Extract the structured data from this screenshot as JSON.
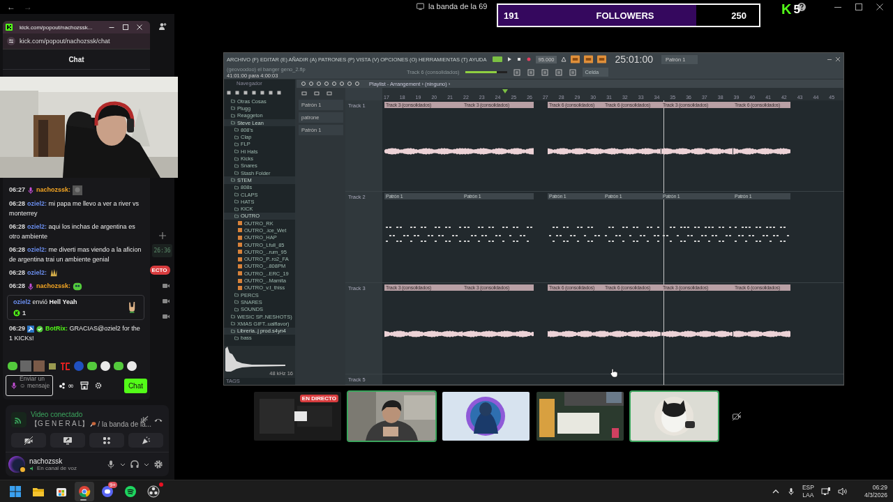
{
  "nav": {
    "back": "←",
    "forward": "→"
  },
  "window": {
    "title": "la banda de la 69"
  },
  "followers_goal": {
    "current": "191",
    "label": "FOLLOWERS",
    "target": "250",
    "level": 0.76
  },
  "kick_badge": {
    "logo": "K",
    "count": "5"
  },
  "popout": {
    "tab_title": "kick.com/popout/nachozssk...",
    "url": "kick.com/popout/nachozssk/chat",
    "header": "Chat"
  },
  "chat": {
    "messages": [
      {
        "kind": "emote",
        "time": "06:27",
        "user": "nachozssk:",
        "color": "#f5a623",
        "mic": true
      },
      {
        "kind": "text",
        "time": "06:28",
        "user": "oziel2:",
        "color": "#6b8ff0",
        "mic": false,
        "text": "mi papa me llevo a ver a river vs monterrey"
      },
      {
        "kind": "text",
        "time": "06:28",
        "user": "oziel2:",
        "color": "#6b8ff0",
        "mic": false,
        "text": "aqui los inchas de argentina es otro ambiente"
      },
      {
        "kind": "text",
        "time": "06:28",
        "user": "oziel2:",
        "color": "#6b8ff0",
        "mic": false,
        "text": "me diverti mas viendo a la aficion de argentina trai un ambiente genial"
      },
      {
        "kind": "emote",
        "time": "06:28",
        "user": "oziel2:",
        "color": "#6b8ff0",
        "mic": false
      },
      {
        "kind": "emote",
        "time": "06:28",
        "user": "nachozssk:",
        "color": "#f5a623",
        "mic": true
      },
      {
        "kind": "gift",
        "user": "oziel2",
        "color": "#6b8ff0",
        "text": "envió **Hell Yeah**",
        "count": "1"
      },
      {
        "kind": "bot",
        "time": "06:29",
        "user": "BotRix:",
        "color": "#53fc18",
        "mic": false,
        "text": "GRACIAS@oziel2 for the 1 KICKs!"
      }
    ],
    "input": {
      "placeholder": "Enviar un ☺ mensaje"
    },
    "infinity": "∞",
    "send_button": "Chat"
  },
  "sidebar_peek": {
    "timer": "26:36",
    "live_badge": "ECTO"
  },
  "voice": {
    "status": "Video conectado",
    "channel": "【G E N E R A L】",
    "channel_rest": "/ la banda de la...",
    "user": "nachozssk",
    "user_status": "En canal de voz"
  },
  "daw": {
    "menu": "ARCHIVO (F) EDITAR (E) AÑADIR (A) PATRONES (P) VISTA (V) OPCIONES (O) HERRAMIENTAS (T) AYUDA",
    "tempo": "95.000",
    "time": "25:01:00",
    "pattern": "Patrón 1",
    "project": "(geovoodoo) el banger geno_2.flp",
    "position": "41:01:00 para 4:00:03",
    "hint": "Track 6 (consolidados)",
    "master_volume": {
      "level": 0.75
    },
    "snap": "Celda",
    "browser_title": "Navegador",
    "browser": [
      {
        "label": "Otras Cosas",
        "kind": "folder"
      },
      {
        "label": "Plugg",
        "kind": "folder"
      },
      {
        "label": "Reaggeton",
        "kind": "folder"
      },
      {
        "label": "Steve Lean",
        "kind": "folder",
        "children": [
          {
            "label": "808's",
            "kind": "folder"
          },
          {
            "label": "Clap",
            "kind": "folder"
          },
          {
            "label": "FLP",
            "kind": "folder"
          },
          {
            "label": "Hi Hats",
            "kind": "folder"
          },
          {
            "label": "Kicks",
            "kind": "folder"
          },
          {
            "label": "Snares",
            "kind": "folder"
          },
          {
            "label": "Stash Folder",
            "kind": "folder"
          }
        ]
      },
      {
        "label": "STEM",
        "kind": "folder",
        "children": [
          {
            "label": "808s",
            "kind": "folder"
          },
          {
            "label": "CLAPS",
            "kind": "folder"
          },
          {
            "label": "HATS",
            "kind": "folder"
          },
          {
            "label": "KICK",
            "kind": "folder"
          },
          {
            "label": "OUTRO",
            "kind": "folder",
            "children": [
              {
                "label": "OUTRO_RK",
                "kind": "file"
              },
              {
                "label": "OUTRO_.ice_Wet",
                "kind": "file"
              },
              {
                "label": "OUTRO_HAP",
                "kind": "file"
              },
              {
                "label": "OUTRO_Lfull_85",
                "kind": "file"
              },
              {
                "label": "OUTRO_..rum_95",
                "kind": "file"
              },
              {
                "label": "OUTRO_P..ro2_FA",
                "kind": "file"
              },
              {
                "label": "OUTRO_..808PM",
                "kind": "file"
              },
              {
                "label": "OUTRO_..ERC_19",
                "kind": "file"
              },
              {
                "label": "OUTRO_..Mamita",
                "kind": "file"
              },
              {
                "label": "OUTRO_v.t_thiss",
                "kind": "file"
              }
            ]
          },
          {
            "label": "PERCS",
            "kind": "folder"
          },
          {
            "label": "SNARES",
            "kind": "folder"
          },
          {
            "label": "SOUNDS",
            "kind": "folder"
          }
        ]
      },
      {
        "label": "WESIC SP..NESHOTS)",
        "kind": "folder"
      },
      {
        "label": "XMAS GIFT..ualflavor)",
        "kind": "folder"
      },
      {
        "label": "Libreria..j prod.s4yn4",
        "kind": "folder",
        "children": [
          {
            "label": "bass",
            "kind": "folder"
          }
        ]
      }
    ],
    "sample_info": "48 kHz 16",
    "tags": "TAGS",
    "playlist_title": "Playlist - Arrangement › (ninguno) ›",
    "patterns": [
      "Patrón 1",
      "patrone",
      "Patrón 1"
    ],
    "ruler": [
      "17",
      "18",
      "19",
      "20",
      "21",
      "22",
      "23",
      "24",
      "25",
      "26",
      "27",
      "28",
      "29",
      "30",
      "31",
      "32",
      "33",
      "34",
      "35",
      "36",
      "37",
      "38",
      "39",
      "40",
      "41",
      "42",
      "43",
      "44",
      "45"
    ],
    "tracks": [
      {
        "name": "Track 1",
        "kind": "audio",
        "clips": [
          "Track 3 (consolidados)",
          "Track 3 (consolidados)",
          "Track 6 (consolidados)",
          "Track 6 (consolidados)",
          "Track 3 (consolidados)",
          "Track 6 (consolidados)"
        ]
      },
      {
        "name": "Track 2",
        "kind": "pattern",
        "clips": [
          "Patrón 1",
          "Patrón 1",
          "Patrón 1",
          "Patrón 1",
          "Patrón 1",
          "Patrón 1"
        ]
      },
      {
        "name": "Track 3",
        "kind": "audio",
        "clips": [
          "Track 3 (consolidados)",
          "Track 3 (consolidados)",
          "Track 6 (consolidados)",
          "Track 6 (consolidados)",
          "Track 3 (consolidados)",
          "Track 6 (consolidados)"
        ]
      },
      {
        "name": "Track 5",
        "kind": "empty"
      }
    ]
  },
  "tiles": [
    {
      "kind": "screen",
      "badge": "EN DIRECTO",
      "speaking": false
    },
    {
      "kind": "camera",
      "speaking": true
    },
    {
      "kind": "avatar",
      "speaking": false
    },
    {
      "kind": "table",
      "speaking": false
    },
    {
      "kind": "cat",
      "speaking": true
    }
  ],
  "taskbar": {
    "apps": [
      {
        "kind": "start",
        "selected": false
      },
      {
        "kind": "files",
        "selected": false
      },
      {
        "kind": "store",
        "selected": false
      },
      {
        "kind": "chrome",
        "selected": true
      },
      {
        "kind": "discord",
        "selected": false,
        "badge": "9+"
      },
      {
        "kind": "spotify",
        "selected": false
      },
      {
        "kind": "obs",
        "selected": false,
        "alert": true
      }
    ],
    "language": "ESP",
    "layout": "LAA",
    "time": "06:29",
    "date": "4/3/2026"
  }
}
